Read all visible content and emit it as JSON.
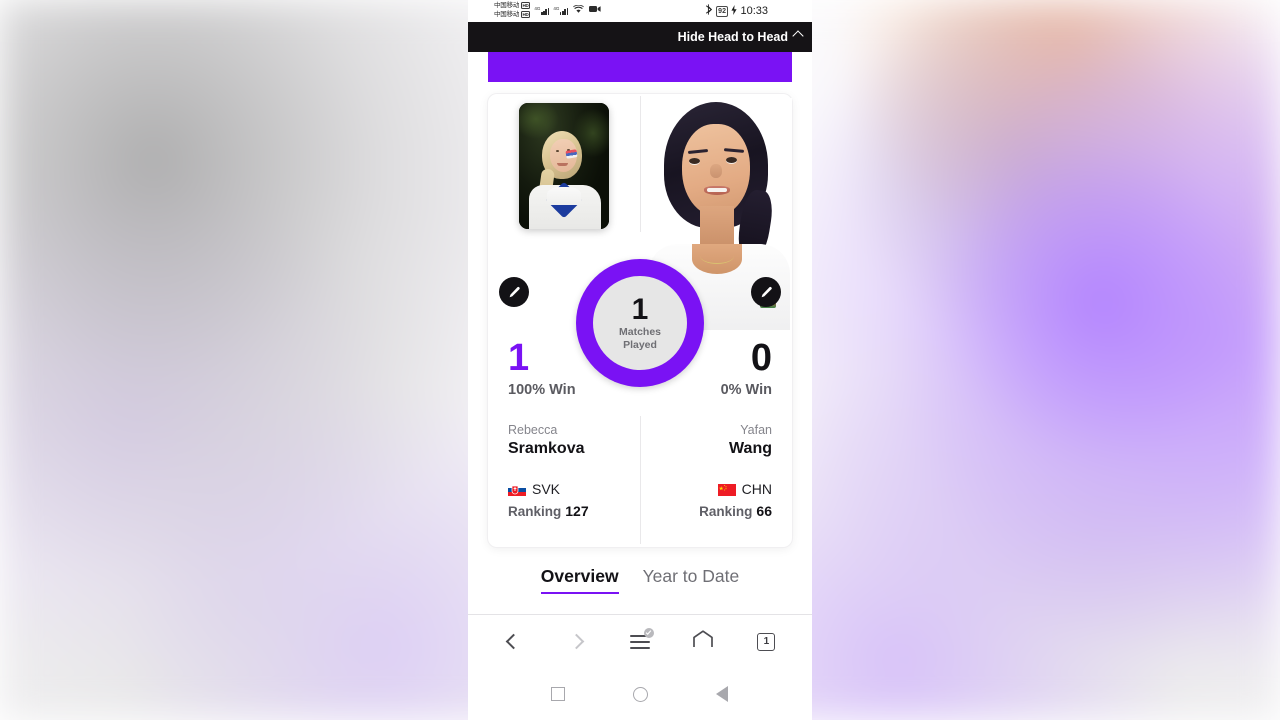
{
  "statusbar": {
    "carrier1": "中国移动",
    "carrier2": "中国移动",
    "hd_badge": "HD",
    "net1": "4G",
    "net2": "4G",
    "battery": "92",
    "clock": "10:33",
    "icons": [
      "signal-icon",
      "wifi-icon",
      "video-icon",
      "bluetooth-icon",
      "battery-icon",
      "charging-bolt-icon"
    ]
  },
  "header": {
    "hide_label": "Hide Head to Head",
    "chevron": "chevron-up-icon"
  },
  "theme": {
    "accent": "#7a12f4",
    "dark": "#131216",
    "muted": "#6f6f75"
  },
  "donut": {
    "value": "1",
    "label_line1": "Matches",
    "label_line2": "Played"
  },
  "players": [
    {
      "side": "left",
      "wins": "1",
      "win_pct": "100% Win",
      "first_name": "Rebecca",
      "last_name": "Sramkova",
      "country_code": "SVK",
      "flag": "slovakia-flag-icon",
      "ranking_label": "Ranking",
      "ranking": "127",
      "edit_label": "edit-icon"
    },
    {
      "side": "right",
      "wins": "0",
      "win_pct": "0% Win",
      "first_name": "Yafan",
      "last_name": "Wang",
      "country_code": "CHN",
      "flag": "china-flag-icon",
      "ranking_label": "Ranking",
      "ranking": "66",
      "edit_label": "edit-icon"
    }
  ],
  "tabs": [
    {
      "label": "Overview",
      "active": true
    },
    {
      "label": "Year to Date",
      "active": false
    }
  ],
  "browser_bar": {
    "back": "back-arrow-icon",
    "forward": "forward-arrow-icon",
    "menu": "hamburger-menu-icon",
    "home": "home-icon",
    "tab_count": "1"
  },
  "android_nav": {
    "recents": "square-recents-icon",
    "home": "circle-home-icon",
    "back": "triangle-back-icon"
  }
}
